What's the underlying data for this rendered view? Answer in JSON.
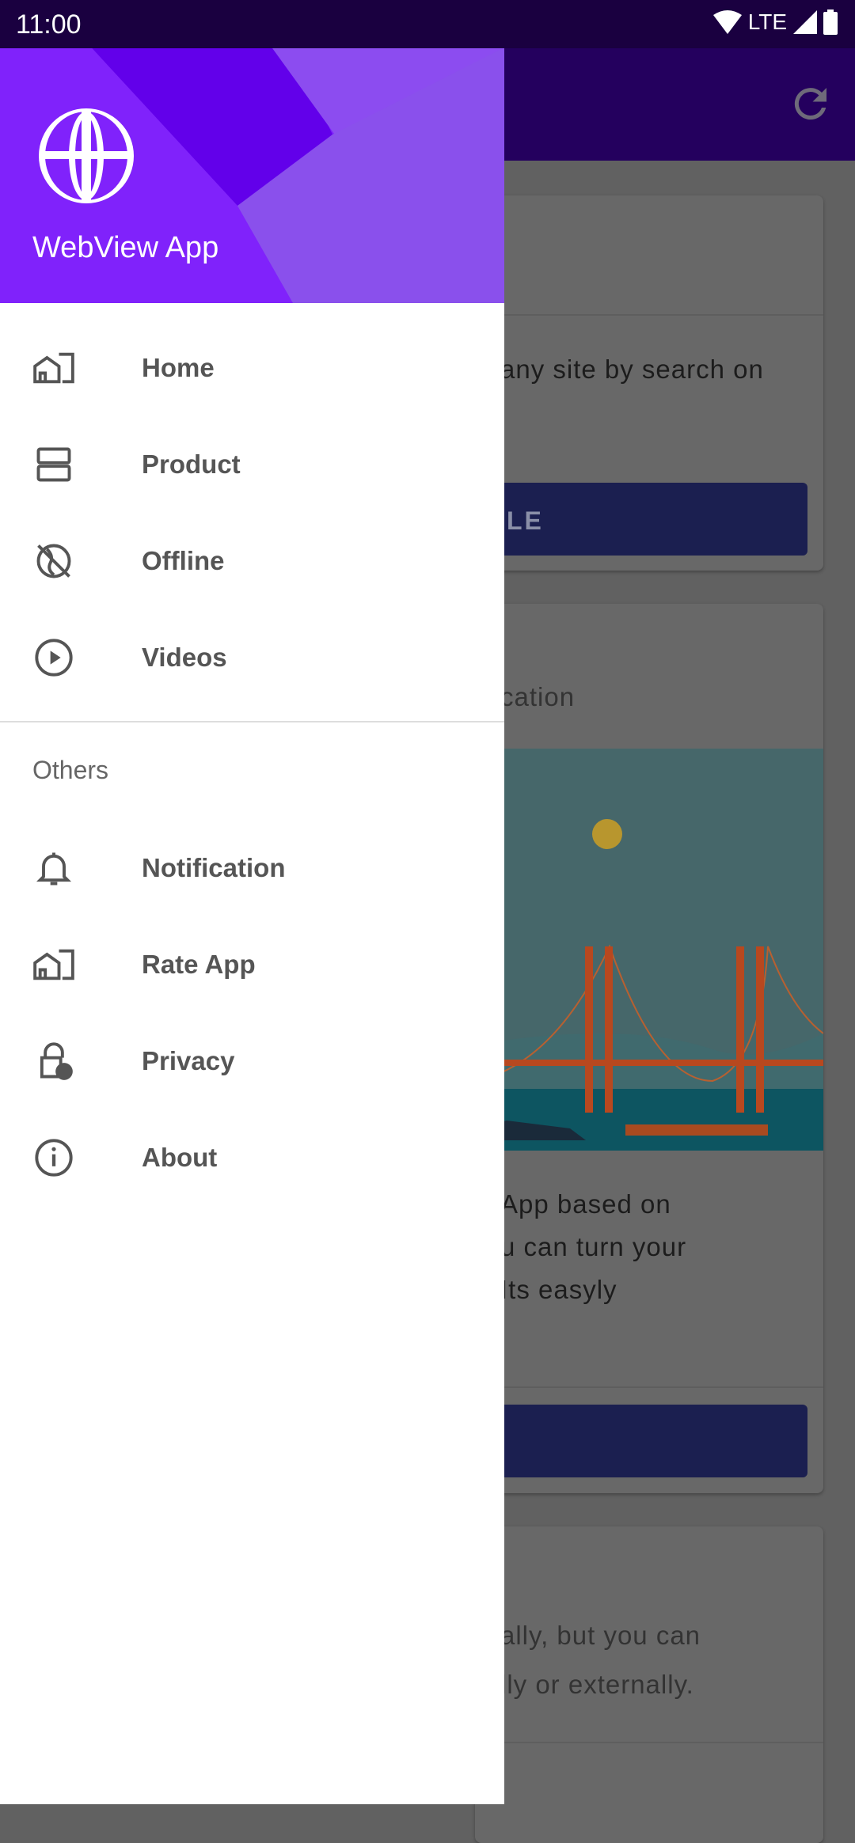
{
  "status_bar": {
    "time": "11:00",
    "network": "LTE",
    "icons": [
      "wifi-icon",
      "signal-icon",
      "battery-icon"
    ]
  },
  "toolbar": {
    "icon": "refresh-icon"
  },
  "background_content": {
    "card1": {
      "text": "any site by search on",
      "button_label": "LE"
    },
    "card2": {
      "title": "cation",
      "lines": [
        "App based on",
        "u can turn your",
        "  Its easyly"
      ]
    },
    "card3": {
      "lines": [
        "ally, but you can",
        "lly or externally."
      ]
    }
  },
  "drawer": {
    "app_title": "WebView App",
    "items": [
      {
        "label": "Home",
        "icon": "home-building-icon"
      },
      {
        "label": "Product",
        "icon": "product-list-icon"
      },
      {
        "label": "Offline",
        "icon": "offline-globe-icon"
      },
      {
        "label": "Videos",
        "icon": "play-circle-icon"
      }
    ],
    "section_title": "Others",
    "others": [
      {
        "label": "Notification",
        "icon": "bell-icon"
      },
      {
        "label": "Rate App",
        "icon": "home-building-icon"
      },
      {
        "label": "Privacy",
        "icon": "lock-person-icon"
      },
      {
        "label": "About",
        "icon": "info-icon"
      }
    ]
  },
  "colors": {
    "header": "#8022fb",
    "toolbar": "#24005e",
    "button": "#1b1f50"
  }
}
